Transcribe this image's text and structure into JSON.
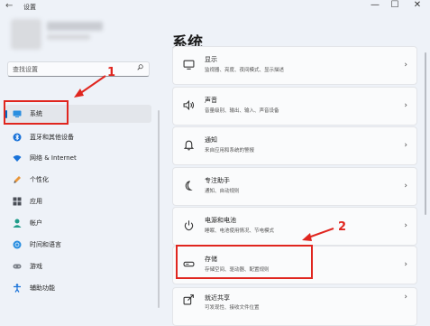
{
  "window": {
    "back_glyph": "←",
    "title": "设置",
    "minimize_glyph": "—",
    "maximize_glyph": "☐",
    "close_glyph": "✕"
  },
  "search": {
    "placeholder": "查找设置"
  },
  "sidebar": {
    "items": [
      {
        "label": "系统",
        "icon": "system-icon"
      },
      {
        "label": "蓝牙和其他设备",
        "icon": "bluetooth-icon"
      },
      {
        "label": "网络 & Internet",
        "icon": "wifi-icon"
      },
      {
        "label": "个性化",
        "icon": "brush-icon"
      },
      {
        "label": "应用",
        "icon": "apps-icon"
      },
      {
        "label": "帐户",
        "icon": "person-icon"
      },
      {
        "label": "时间和语言",
        "icon": "globe-icon"
      },
      {
        "label": "游戏",
        "icon": "game-icon"
      },
      {
        "label": "辅助功能",
        "icon": "accessibility-icon"
      }
    ]
  },
  "main": {
    "title": "系统",
    "cards": [
      {
        "title": "显示",
        "subtitle": "监视器、亮度、夜间模式、显示描述",
        "icon": "monitor-icon"
      },
      {
        "title": "声音",
        "subtitle": "音量级别、输出、输入、声音设备",
        "icon": "speaker-icon"
      },
      {
        "title": "通知",
        "subtitle": "来自应用和系统的警报",
        "icon": "bell-icon"
      },
      {
        "title": "专注助手",
        "subtitle": "通知、自动规则",
        "icon": "moon-icon"
      },
      {
        "title": "电源和电池",
        "subtitle": "睡眠、电池使用情况、节电模式",
        "icon": "power-icon"
      },
      {
        "title": "存储",
        "subtitle": "存储空间、驱动器、配置规则",
        "icon": "storage-icon"
      },
      {
        "title": "就近共享",
        "subtitle": "可发现性、接收文件位置",
        "icon": "share-icon"
      }
    ]
  },
  "annotations": {
    "step1": "1",
    "step2": "2"
  },
  "colors": {
    "accent": "#0067c0",
    "annotation": "#e0261f"
  }
}
